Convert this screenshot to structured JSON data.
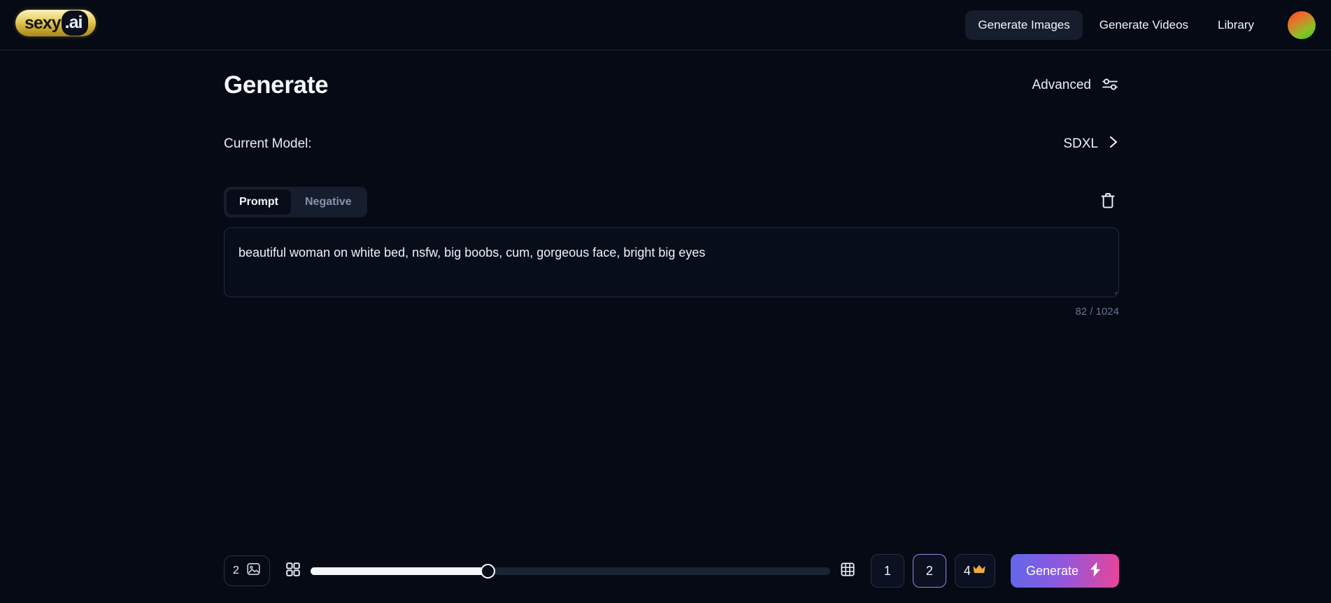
{
  "header": {
    "logo": {
      "part1": "sexy",
      "part2": ".ai",
      "name": "sexy.ai"
    },
    "nav": [
      {
        "label": "Generate Images",
        "active": true
      },
      {
        "label": "Generate Videos",
        "active": false
      },
      {
        "label": "Library",
        "active": false
      }
    ],
    "avatar_colors": [
      "#f04a2a",
      "#35cc2e"
    ]
  },
  "main": {
    "page_title": "Generate",
    "advanced_label": "Advanced",
    "advanced_icon": "sliders-icon",
    "model_label": "Current Model:",
    "model_value": "SDXL",
    "model_chevron_icon": "chevron-right-icon",
    "tabs": [
      {
        "label": "Prompt",
        "active": true
      },
      {
        "label": "Negative",
        "active": false
      }
    ],
    "clear_icon": "trash-icon",
    "prompt": {
      "value": "beautiful woman on white bed, nsfw, big boobs, cum, gorgeous face, bright big eyes",
      "placeholder": "",
      "counter": "82 / 1024",
      "char_count": 82,
      "char_max": 1024
    }
  },
  "bottom_bar": {
    "image_count_badge": "2",
    "image_icon": "image-icon",
    "small_grid_icon": "grid-2x2-icon",
    "large_grid_icon": "grid-3x3-icon",
    "slider_percent": 34,
    "counts": [
      {
        "label": "1",
        "selected": false,
        "premium": false
      },
      {
        "label": "2",
        "selected": true,
        "premium": false
      },
      {
        "label": "4",
        "selected": false,
        "premium": true,
        "crown_icon": "crown-icon"
      }
    ],
    "generate_label": "Generate",
    "generate_icon": "lightning-bolt-icon",
    "accent_gradient": [
      "#6168ea",
      "#e8459a"
    ]
  }
}
